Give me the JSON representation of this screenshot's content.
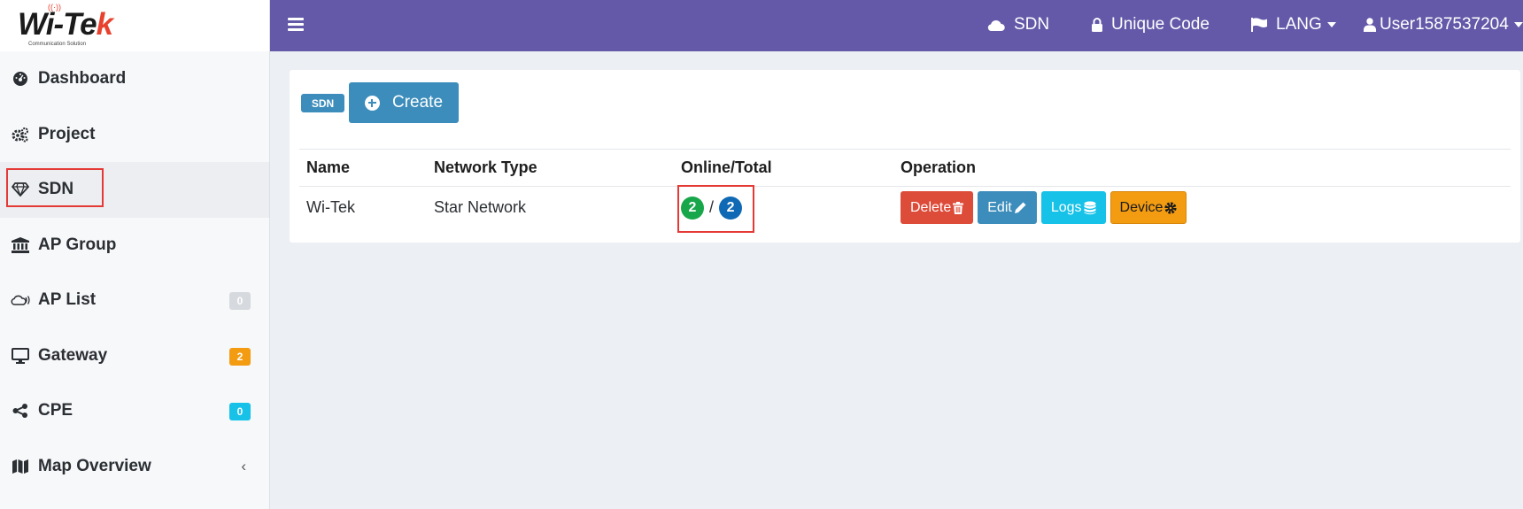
{
  "brand": {
    "logo_text_main": "Wi-Te",
    "logo_text_accent": "k",
    "logo_tagline": "Communication Solution"
  },
  "sidebar": {
    "items": [
      {
        "label": "Dashboard",
        "icon": "dashboard-icon"
      },
      {
        "label": "Project",
        "icon": "cogs-icon"
      },
      {
        "label": "SDN",
        "icon": "diamond-icon",
        "active": true
      },
      {
        "label": "AP Group",
        "icon": "bank-icon"
      },
      {
        "label": "AP List",
        "icon": "cloud-wifi-icon",
        "badge": "0",
        "badge_color": "#d6d9de"
      },
      {
        "label": "Gateway",
        "icon": "monitor-icon",
        "badge": "2",
        "badge_color": "#f39c12"
      },
      {
        "label": "CPE",
        "icon": "share-icon",
        "badge": "0",
        "badge_color": "#17c1e8"
      },
      {
        "label": "Map Overview",
        "icon": "map-icon",
        "chevron": "‹"
      }
    ]
  },
  "topbar": {
    "sdn_label": "SDN",
    "unique_code_label": "Unique Code",
    "lang_label": "LANG",
    "user_label": "User1587537204"
  },
  "content": {
    "tag_label": "SDN",
    "create_label": "Create",
    "table": {
      "headers": [
        "Name",
        "Network Type",
        "Online/Total",
        "Operation"
      ],
      "rows": [
        {
          "name": "Wi-Tek",
          "network_type": "Star Network",
          "online": "2",
          "separator": "/",
          "total": "2"
        }
      ]
    },
    "operations": {
      "delete": "Delete",
      "edit": "Edit",
      "logs": "Logs",
      "device": "Device"
    }
  },
  "colors": {
    "topbar": "#6359a8",
    "primary": "#3c8dbc",
    "danger": "#dd4b39",
    "info": "#16c2e8",
    "warning": "#f39c12",
    "online": "#17a74a",
    "total": "#1069b4"
  }
}
